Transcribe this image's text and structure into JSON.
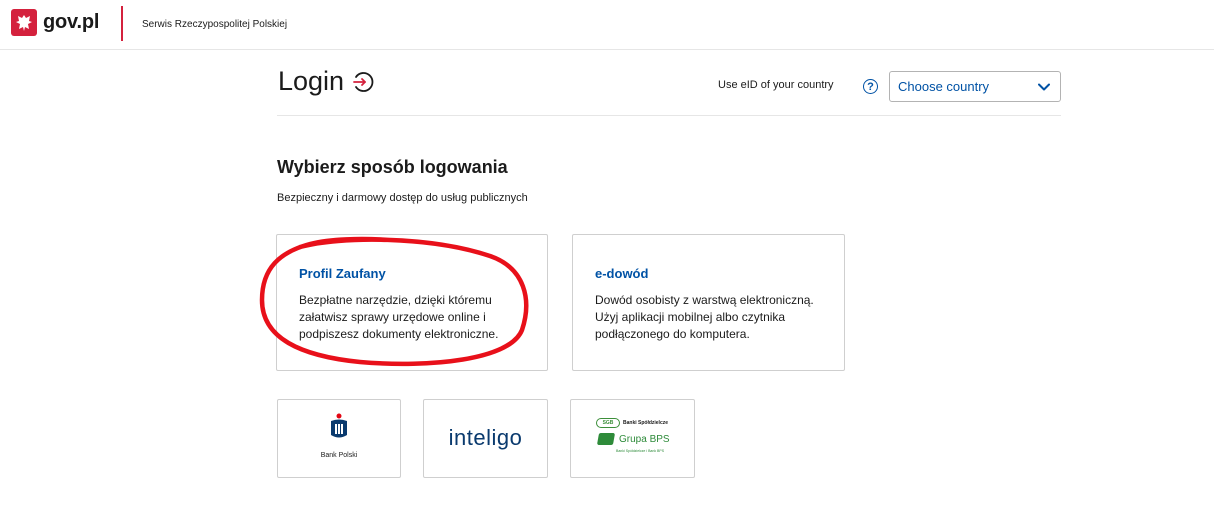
{
  "header": {
    "logo_text": "gov.pl",
    "tagline": "Serwis Rzeczypospolitej Polskiej",
    "emblem_icon": "polish-eagle-icon"
  },
  "top": {
    "login_title": "Login",
    "login_icon": "login-arrow-icon",
    "eid_label": "Use eID of your country",
    "help_symbol": "?",
    "country_select": {
      "selected": "Choose country"
    }
  },
  "section": {
    "title": "Wybierz sposób logowania",
    "subtitle": "Bezpieczny i darmowy dostęp do usług publicznych"
  },
  "methods": [
    {
      "title": "Profil Zaufany",
      "description": "Bezpłatne narzędzie, dzięki któremu załatwisz sprawy urzędowe online i podpiszesz dokumenty elektroniczne."
    },
    {
      "title": "e-dowód",
      "description": "Dowód osobisty z warstwą elektroniczną. Użyj aplikacji mobilnej albo czytnika podłączonego do komputera."
    }
  ],
  "banks": {
    "pko": {
      "caption": "Bank Polski",
      "icon": "pko-bp-logo-icon"
    },
    "inteligo": {
      "name": "inteligo"
    },
    "bps": {
      "badge": "SGB",
      "top_text": "Banki Spółdzielcze",
      "name": "Grupa BPS",
      "bottom_text": "Banki Spółdzielcze i Bank BPS"
    }
  },
  "colors": {
    "brand_red": "#d4213d",
    "link_blue": "#0052a5",
    "annotation_red": "#e8101a"
  }
}
